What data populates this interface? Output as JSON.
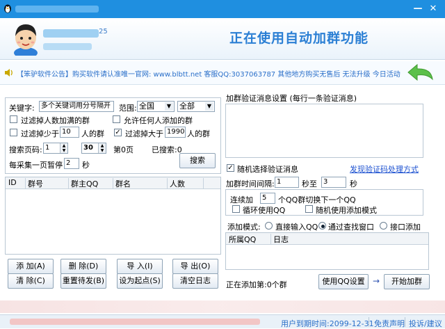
{
  "window": {
    "minimize_glyph": "—",
    "close_glyph": "✕"
  },
  "header": {
    "user_suffix": "25",
    "banner": "正在使用自动加群功能"
  },
  "notice": {
    "text": "【笨驴软件公告】购买软件请认准唯一官网: www.blbtt.net 客服QQ:3037063787 其他地方购买无售后 无法升级 今日活动"
  },
  "search": {
    "keyword_label": "关键字:",
    "keyword_value": "多个关键词用分号隔开",
    "range_label": "范围:",
    "range_value": "全国",
    "range_value2": "全部",
    "filter_full_label": "过滤掉人数加满的群",
    "filter_full_checked": false,
    "allow_anyone_label": "允许任何人添加的群",
    "allow_anyone_checked": false,
    "filter_less_label": "过滤掉少于",
    "filter_less_value": "10",
    "filter_less_unit": "人的群",
    "filter_less_checked": false,
    "filter_more_label": "过滤掉大于",
    "filter_more_value": "1990",
    "filter_more_unit": "人的群",
    "filter_more_checked": true,
    "page_label": "搜索页码:",
    "page_from": "1",
    "page_to": "30",
    "page_current": "第0页",
    "searched": "已搜索:0",
    "pause_label": "每采集一页暂停",
    "pause_value": "2",
    "pause_unit": "秒",
    "search_button": "搜索"
  },
  "table": {
    "columns": [
      "ID",
      "群号",
      "群主QQ",
      "群名",
      "人数"
    ]
  },
  "buttons": {
    "add": "添 加(A)",
    "delete": "删 除(D)",
    "import": "导 入(I)",
    "export": "导 出(O)",
    "clear": "清 除(C)",
    "reset": "重置待发(B)",
    "set_start": "设为起点(S)",
    "clear_log": "清空日志"
  },
  "verify": {
    "title": "加群验证消息设置 (每行一条验证消息)",
    "random_label": "随机选择验证消息",
    "random_checked": true,
    "captcha_link": "发现验证码处理方式"
  },
  "timing": {
    "interval_label": "加群时间间隔:",
    "interval_from": "1",
    "to_label": "秒至",
    "interval_to": "3",
    "unit": "秒",
    "continuous_label": "连续加",
    "continuous_value": "5",
    "continuous_suffix": "个QQ群切换下一个QQ",
    "loop_label": "循环使用QQ",
    "loop_checked": false,
    "random_mode_label": "随机使用添加模式",
    "random_mode_checked": false
  },
  "mode": {
    "label": "添加模式:",
    "options": [
      "直接输入QQ",
      "通过查找窗口",
      "接口添加"
    ],
    "selected": 1
  },
  "log": {
    "columns": [
      "所属QQ",
      "日志"
    ]
  },
  "footer": {
    "progress": "正在添加第:0个群",
    "use_qq_button": "使用QQ设置",
    "arrow": "→",
    "start_button": "开始加群"
  },
  "status": {
    "expire": "用户到期时间:2099-12-31",
    "disclaimer": "免责声明",
    "feedback": "投诉/建议"
  },
  "colors": {
    "titlebar": "#1f8fe0",
    "banner": "#2b7fd4",
    "link": "#2a6fc9"
  }
}
